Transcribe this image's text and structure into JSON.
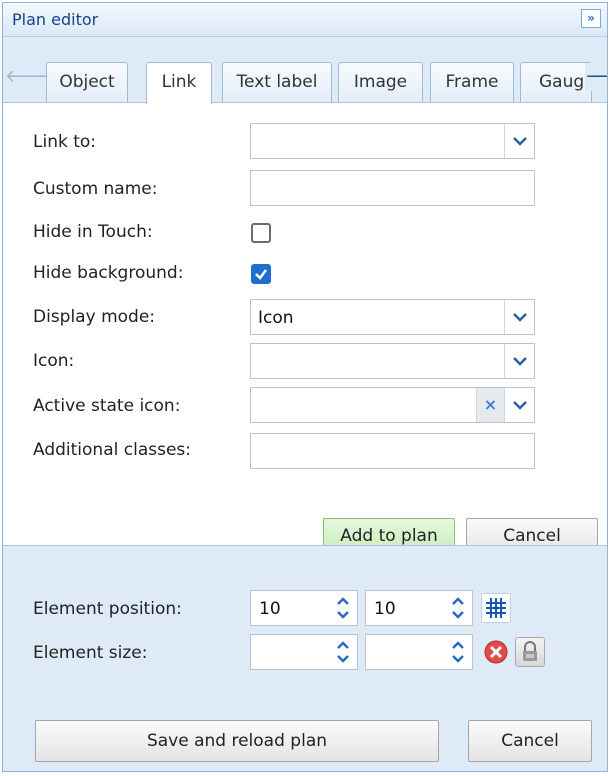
{
  "panel": {
    "title": "Plan editor",
    "collapse_label": "»"
  },
  "tabs": [
    {
      "label": "Object",
      "active": false
    },
    {
      "label": "Link",
      "active": true
    },
    {
      "label": "Text label",
      "active": false
    },
    {
      "label": "Image",
      "active": false
    },
    {
      "label": "Frame",
      "active": false
    },
    {
      "label": "Gaug",
      "active": false
    }
  ],
  "form": {
    "link_to": {
      "label": "Link to:",
      "value": ""
    },
    "custom_name": {
      "label": "Custom name:",
      "value": ""
    },
    "hide_in_touch": {
      "label": "Hide in Touch:",
      "checked": false
    },
    "hide_background": {
      "label": "Hide background:",
      "checked": true
    },
    "display_mode": {
      "label": "Display mode:",
      "value": "Icon"
    },
    "icon": {
      "label": "Icon:",
      "value": ""
    },
    "active_state_icon": {
      "label": "Active state icon:",
      "value": "",
      "clear_glyph": "×"
    },
    "additional_classes": {
      "label": "Additional classes:",
      "value": ""
    },
    "add_button": "Add to plan",
    "cancel_button": "Cancel"
  },
  "bottom": {
    "position_label": "Element position:",
    "position_x": "10",
    "position_y": "10",
    "size_label": "Element size:",
    "size_w": "",
    "size_h": "",
    "save_button": "Save and reload plan",
    "cancel_button": "Cancel"
  },
  "colors": {
    "accent": "#1f6fd1",
    "panel_bg": "#dfeaf7",
    "add_button_bg": "#c7ecb8",
    "remove_icon": "#e04b4b"
  },
  "icons": [
    "chevron-down-icon",
    "clear-icon",
    "spin-up-down-icon",
    "grid-icon",
    "remove-icon",
    "lock-icon",
    "arrow-left-icon",
    "arrow-right-icon"
  ]
}
